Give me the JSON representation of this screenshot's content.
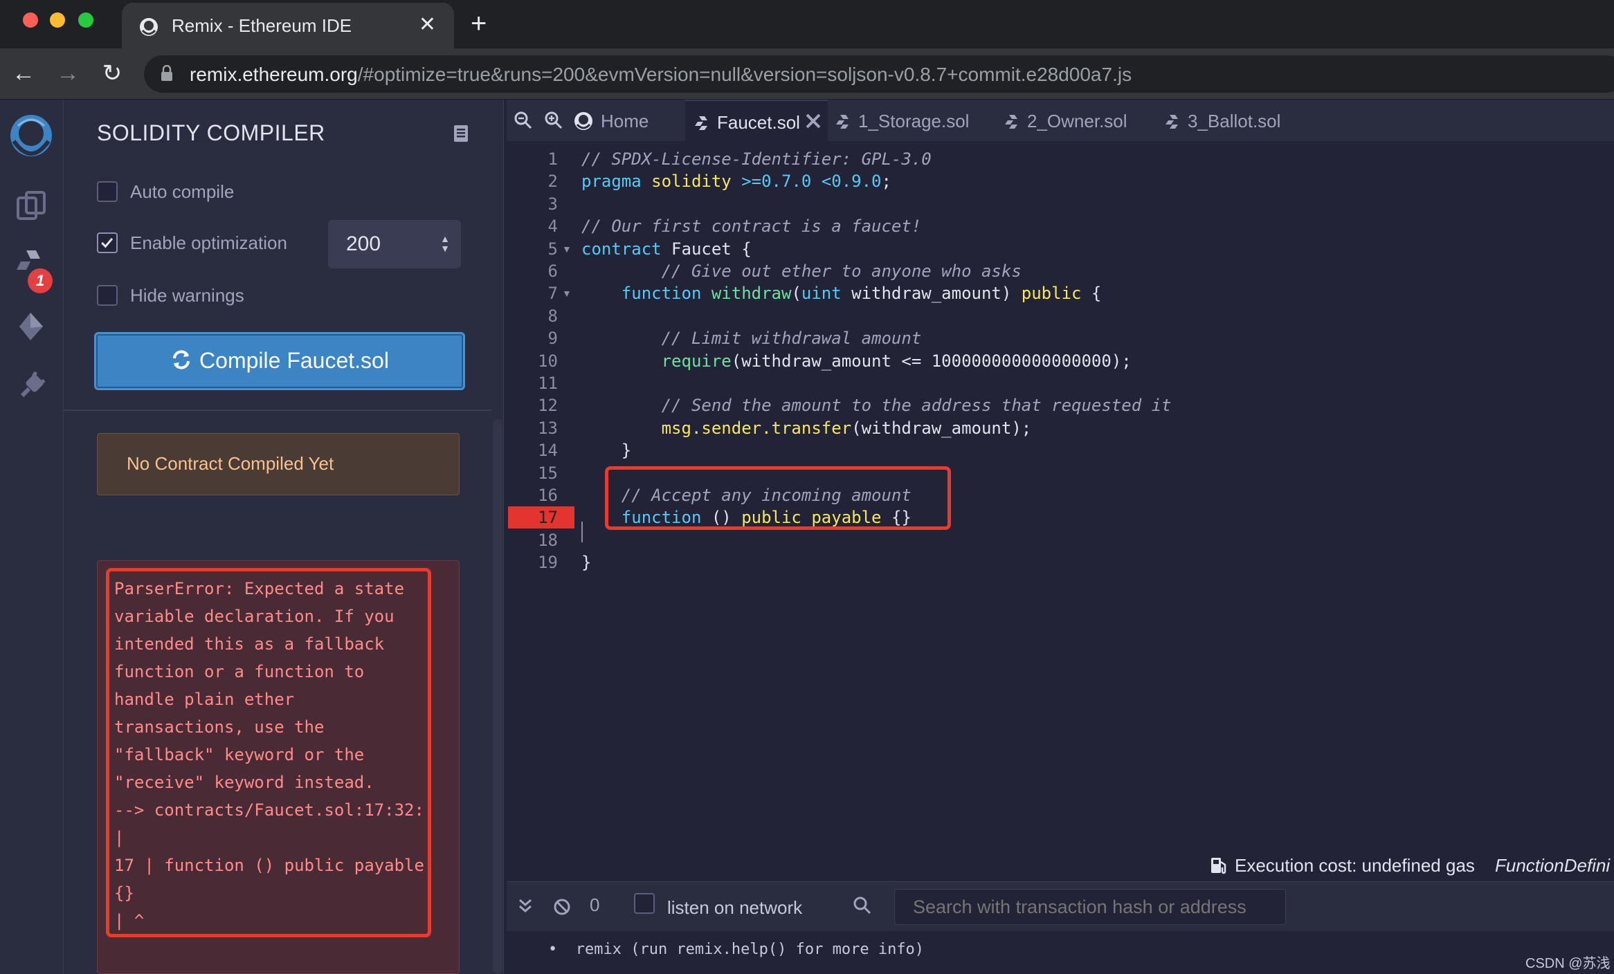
{
  "browser": {
    "tab_title": "Remix - Ethereum IDE",
    "url_host": "remix.ethereum.org",
    "url_rest": "/#optimize=true&runs=200&evmVersion=null&version=soljson-v0.8.7+commit.e28d00a7.js"
  },
  "icon_panel": {
    "items": [
      "remix-logo-icon",
      "file-explorer-icon",
      "solidity-compiler-icon",
      "deploy-run-icon",
      "plugin-manager-icon"
    ],
    "compiler_badge": "1"
  },
  "compiler": {
    "title": "SOLIDITY COMPILER",
    "auto_compile_label": "Auto compile",
    "auto_compile_checked": false,
    "enable_optimization_label": "Enable optimization",
    "enable_optimization_checked": true,
    "runs_value": "200",
    "hide_warnings_label": "Hide warnings",
    "hide_warnings_checked": false,
    "compile_button_label": "Compile Faucet.sol",
    "no_contract_text": "No Contract Compiled Yet",
    "error_text": "ParserError: Expected a state\nvariable declaration. If you\nintended this as a fallback\nfunction or a function to\nhandle plain ether\ntransactions, use the\n\"fallback\" keyword or the\n\"receive\" keyword instead.\n--> contracts/Faucet.sol:17:32:\n|\n17 | function () public payable\n{}\n| ^"
  },
  "editor": {
    "tabs": [
      {
        "label": "Home",
        "active": false
      },
      {
        "label": "Faucet.sol",
        "active": true
      },
      {
        "label": "1_Storage.sol",
        "active": false
      },
      {
        "label": "2_Owner.sol",
        "active": false
      },
      {
        "label": "3_Ballot.sol",
        "active": false
      }
    ],
    "error_line": 17,
    "line_numbers": [
      "1",
      "2",
      "3",
      "4",
      "5",
      "6",
      "7",
      "8",
      "9",
      "10",
      "11",
      "12",
      "13",
      "14",
      "15",
      "16",
      "17",
      "18",
      "19"
    ],
    "code_lines": [
      "// SPDX-License-Identifier: GPL-3.0",
      "pragma solidity >=0.7.0 <0.9.0;",
      "",
      "// Our first contract is a faucet!",
      "contract Faucet {",
      "        // Give out ether to anyone who asks",
      "    function withdraw(uint withdraw_amount) public {",
      "",
      "        // Limit withdrawal amount",
      "        require(withdraw_amount <= 100000000000000000);",
      "",
      "        // Send the amount to the address that requested it",
      "        msg.sender.transfer(withdraw_amount);",
      "    }",
      "",
      "    // Accept any incoming amount",
      "    function () public payable {}",
      "",
      "}"
    ],
    "exec_cost": "Execution cost: undefined gas",
    "function_def": "FunctionDefini"
  },
  "terminal": {
    "count": "0",
    "listen_label": "listen on network",
    "search_placeholder": "Search with transaction hash or address",
    "output_line": "•  remix (run remix.help() for more info)"
  },
  "watermark": "CSDN @苏浅",
  "colors": {
    "error_red": "#e53c2e",
    "compile_blue": "#3c84c4",
    "keyword": "#5ac8f5",
    "comment": "#a2a3bd"
  }
}
